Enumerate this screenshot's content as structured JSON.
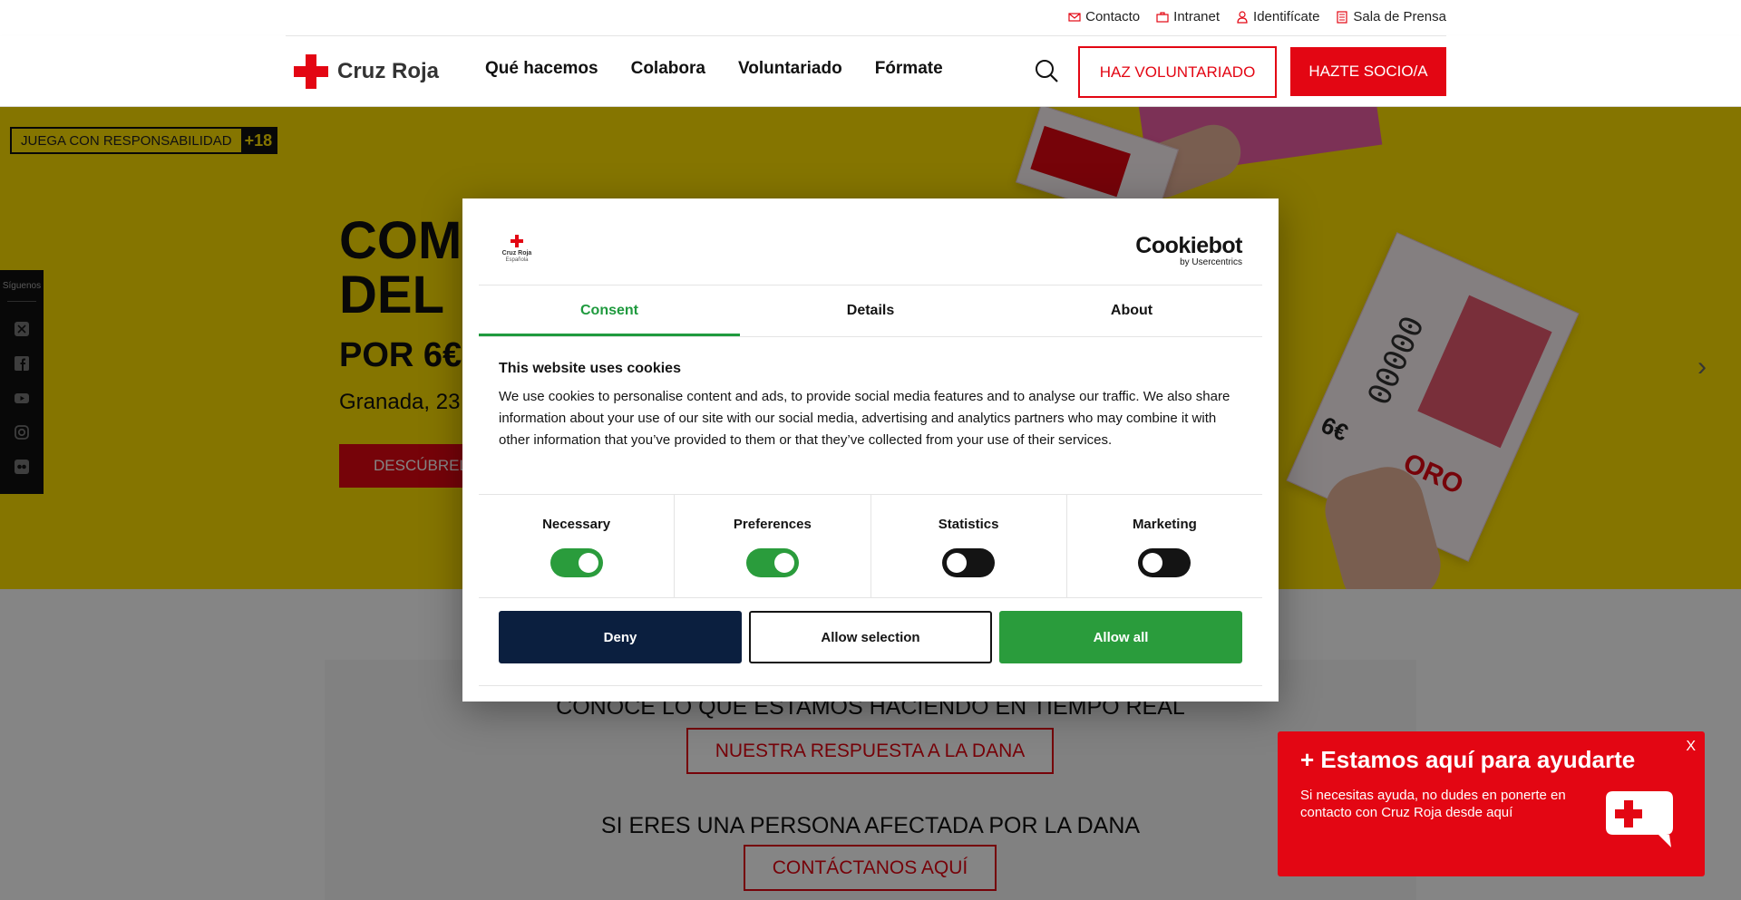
{
  "header": {
    "top_links": [
      {
        "label": "Contacto",
        "icon": "envelope-icon"
      },
      {
        "label": "Intranet",
        "icon": "briefcase-icon"
      },
      {
        "label": "Identifícate",
        "icon": "user-icon"
      },
      {
        "label": "Sala de Prensa",
        "icon": "document-icon"
      }
    ],
    "logo_text": "Cruz Roja",
    "nav": [
      "Qué hacemos",
      "Colabora",
      "Voluntariado",
      "Fórmate"
    ],
    "btn_volunteer": "HAZ VOLUNTARIADO",
    "btn_member": "HAZTE SOCIO/A"
  },
  "hero": {
    "badge_text": "JUEGA CON RESPONSABILIDAD",
    "badge_age": "+18",
    "title_line1": "COM",
    "title_line2": "DEL",
    "subtitle": "POR 6€",
    "date": "Granada, 23",
    "cta": "DESCÚBREL",
    "social_label": "Síguenos",
    "ticket_number": "00000",
    "ticket_price": "6€",
    "ticket_text": "ORO"
  },
  "lower": {
    "heading1": "CONOCE LO QUE ESTAMOS HACIENDO EN TIEMPO REAL",
    "button1": "NUESTRA RESPUESTA A LA DANA",
    "heading2": "SI ERES UNA PERSONA AFECTADA POR LA DANA",
    "button2": "CONTÁCTANOS AQUÍ"
  },
  "cookie": {
    "logo_line1": "Cruz Roja",
    "logo_line2": "Española",
    "brand": "Cookiebot",
    "brand_sub": "by Usercentrics",
    "tabs": [
      "Consent",
      "Details",
      "About"
    ],
    "active_tab": "Consent",
    "title": "This website uses cookies",
    "body": "We use cookies to personalise content and ads, to provide social media features and to analyse our traffic. We also share information about your use of our site with our social media, advertising and analytics partners who may combine it with other information that you’ve provided to them or that they’ve collected from your use of their services.",
    "categories": [
      {
        "name": "Necessary",
        "on": true
      },
      {
        "name": "Preferences",
        "on": true
      },
      {
        "name": "Statistics",
        "on": false
      },
      {
        "name": "Marketing",
        "on": false
      }
    ],
    "btn_deny": "Deny",
    "btn_selection": "Allow selection",
    "btn_all": "Allow all"
  },
  "help_widget": {
    "title": "+ Estamos aquí para ayudarte",
    "body": "Si necesitas ayuda, no dudes en ponerte en contacto con Cruz Roja desde aquí",
    "close": "X"
  },
  "colors": {
    "brand_red": "#e30613",
    "hero_yellow": "#ffe000",
    "cookie_green": "#1f9a3e",
    "deny_navy": "#0b1f3f",
    "toggle_off": "#141414"
  }
}
